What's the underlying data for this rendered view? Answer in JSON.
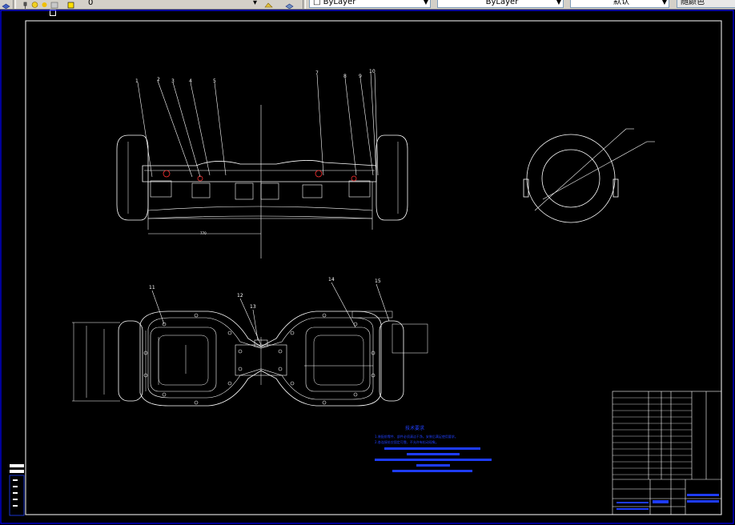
{
  "toolbar": {
    "layer_value": "0",
    "linetype_value": "ByLayer",
    "lineweight_value": "ByLayer",
    "plotstyle_value": "默认",
    "color_label": "随颜色"
  },
  "drawing": {
    "front_view": {
      "part_numbers_left": [
        "1",
        "2",
        "3",
        "4",
        "5"
      ],
      "part_numbers_right": [
        "7",
        "8",
        "9",
        "10"
      ]
    },
    "top_view": {
      "part_numbers": [
        "11",
        "12",
        "13",
        "14",
        "15"
      ]
    },
    "tech_requirements": {
      "title": "技术要求",
      "line1": "1.装配前零件、部件必须清洁干净。安装后满足使用要求。",
      "line2": "2.各连接处应固定可靠，不允许有松动现象。"
    }
  },
  "colors": {
    "background": "#000000",
    "linework": "#ffffff",
    "border": "#0000ff",
    "highlight": "#1e3cff",
    "toolbar": "#d4d0c8"
  }
}
